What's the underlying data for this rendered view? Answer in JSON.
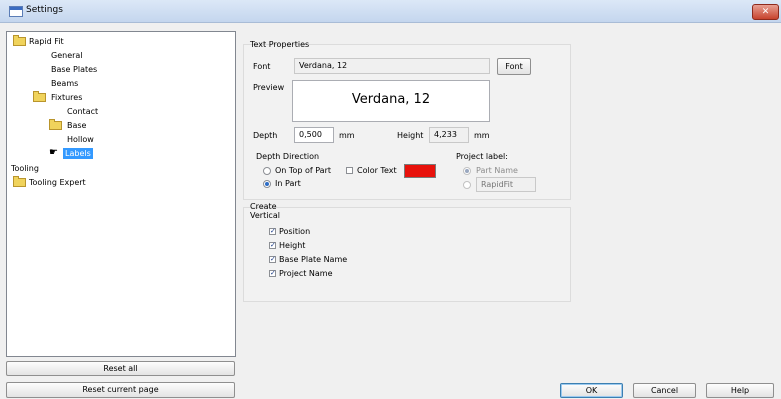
{
  "window": {
    "title": "Settings",
    "close_label": "✕"
  },
  "tree": {
    "items": [
      {
        "label": "Rapid Fit"
      },
      {
        "label": "General"
      },
      {
        "label": "Base Plates"
      },
      {
        "label": "Beams"
      },
      {
        "label": "Fixtures"
      },
      {
        "label": "Contact"
      },
      {
        "label": "Base"
      },
      {
        "label": "Hollow"
      },
      {
        "label": "Labels"
      },
      {
        "label": "Tooling"
      },
      {
        "label": "Tooling Expert"
      }
    ]
  },
  "buttons": {
    "reset_all": "Reset all",
    "reset_current": "Reset current page",
    "ok": "OK",
    "cancel": "Cancel",
    "help": "Help",
    "font": "Font"
  },
  "text_properties": {
    "title": "Text Properties",
    "font_label": "Font",
    "font_value": "Verdana, 12",
    "preview_label": "Preview",
    "preview_text": "Verdana, 12",
    "depth_label": "Depth",
    "depth_value": "0,500",
    "depth_unit": "mm",
    "height_label": "Height",
    "height_value": "4,233",
    "height_unit": "mm",
    "depth_direction_label": "Depth Direction",
    "on_top_label": "On Top of Part",
    "in_part_label": "In Part",
    "color_text_label": "Color Text",
    "color_swatch": "#e8120c",
    "project_label_title": "Project label:",
    "part_name_label": "Part Name",
    "rapidfit_placeholder": "RapidFit"
  },
  "create": {
    "title": "Create",
    "subtitle": "Vertical",
    "options": [
      {
        "label": "Position",
        "checked": true
      },
      {
        "label": "Height",
        "checked": true
      },
      {
        "label": "Base Plate Name",
        "checked": true
      },
      {
        "label": "Project Name",
        "checked": true
      }
    ]
  }
}
